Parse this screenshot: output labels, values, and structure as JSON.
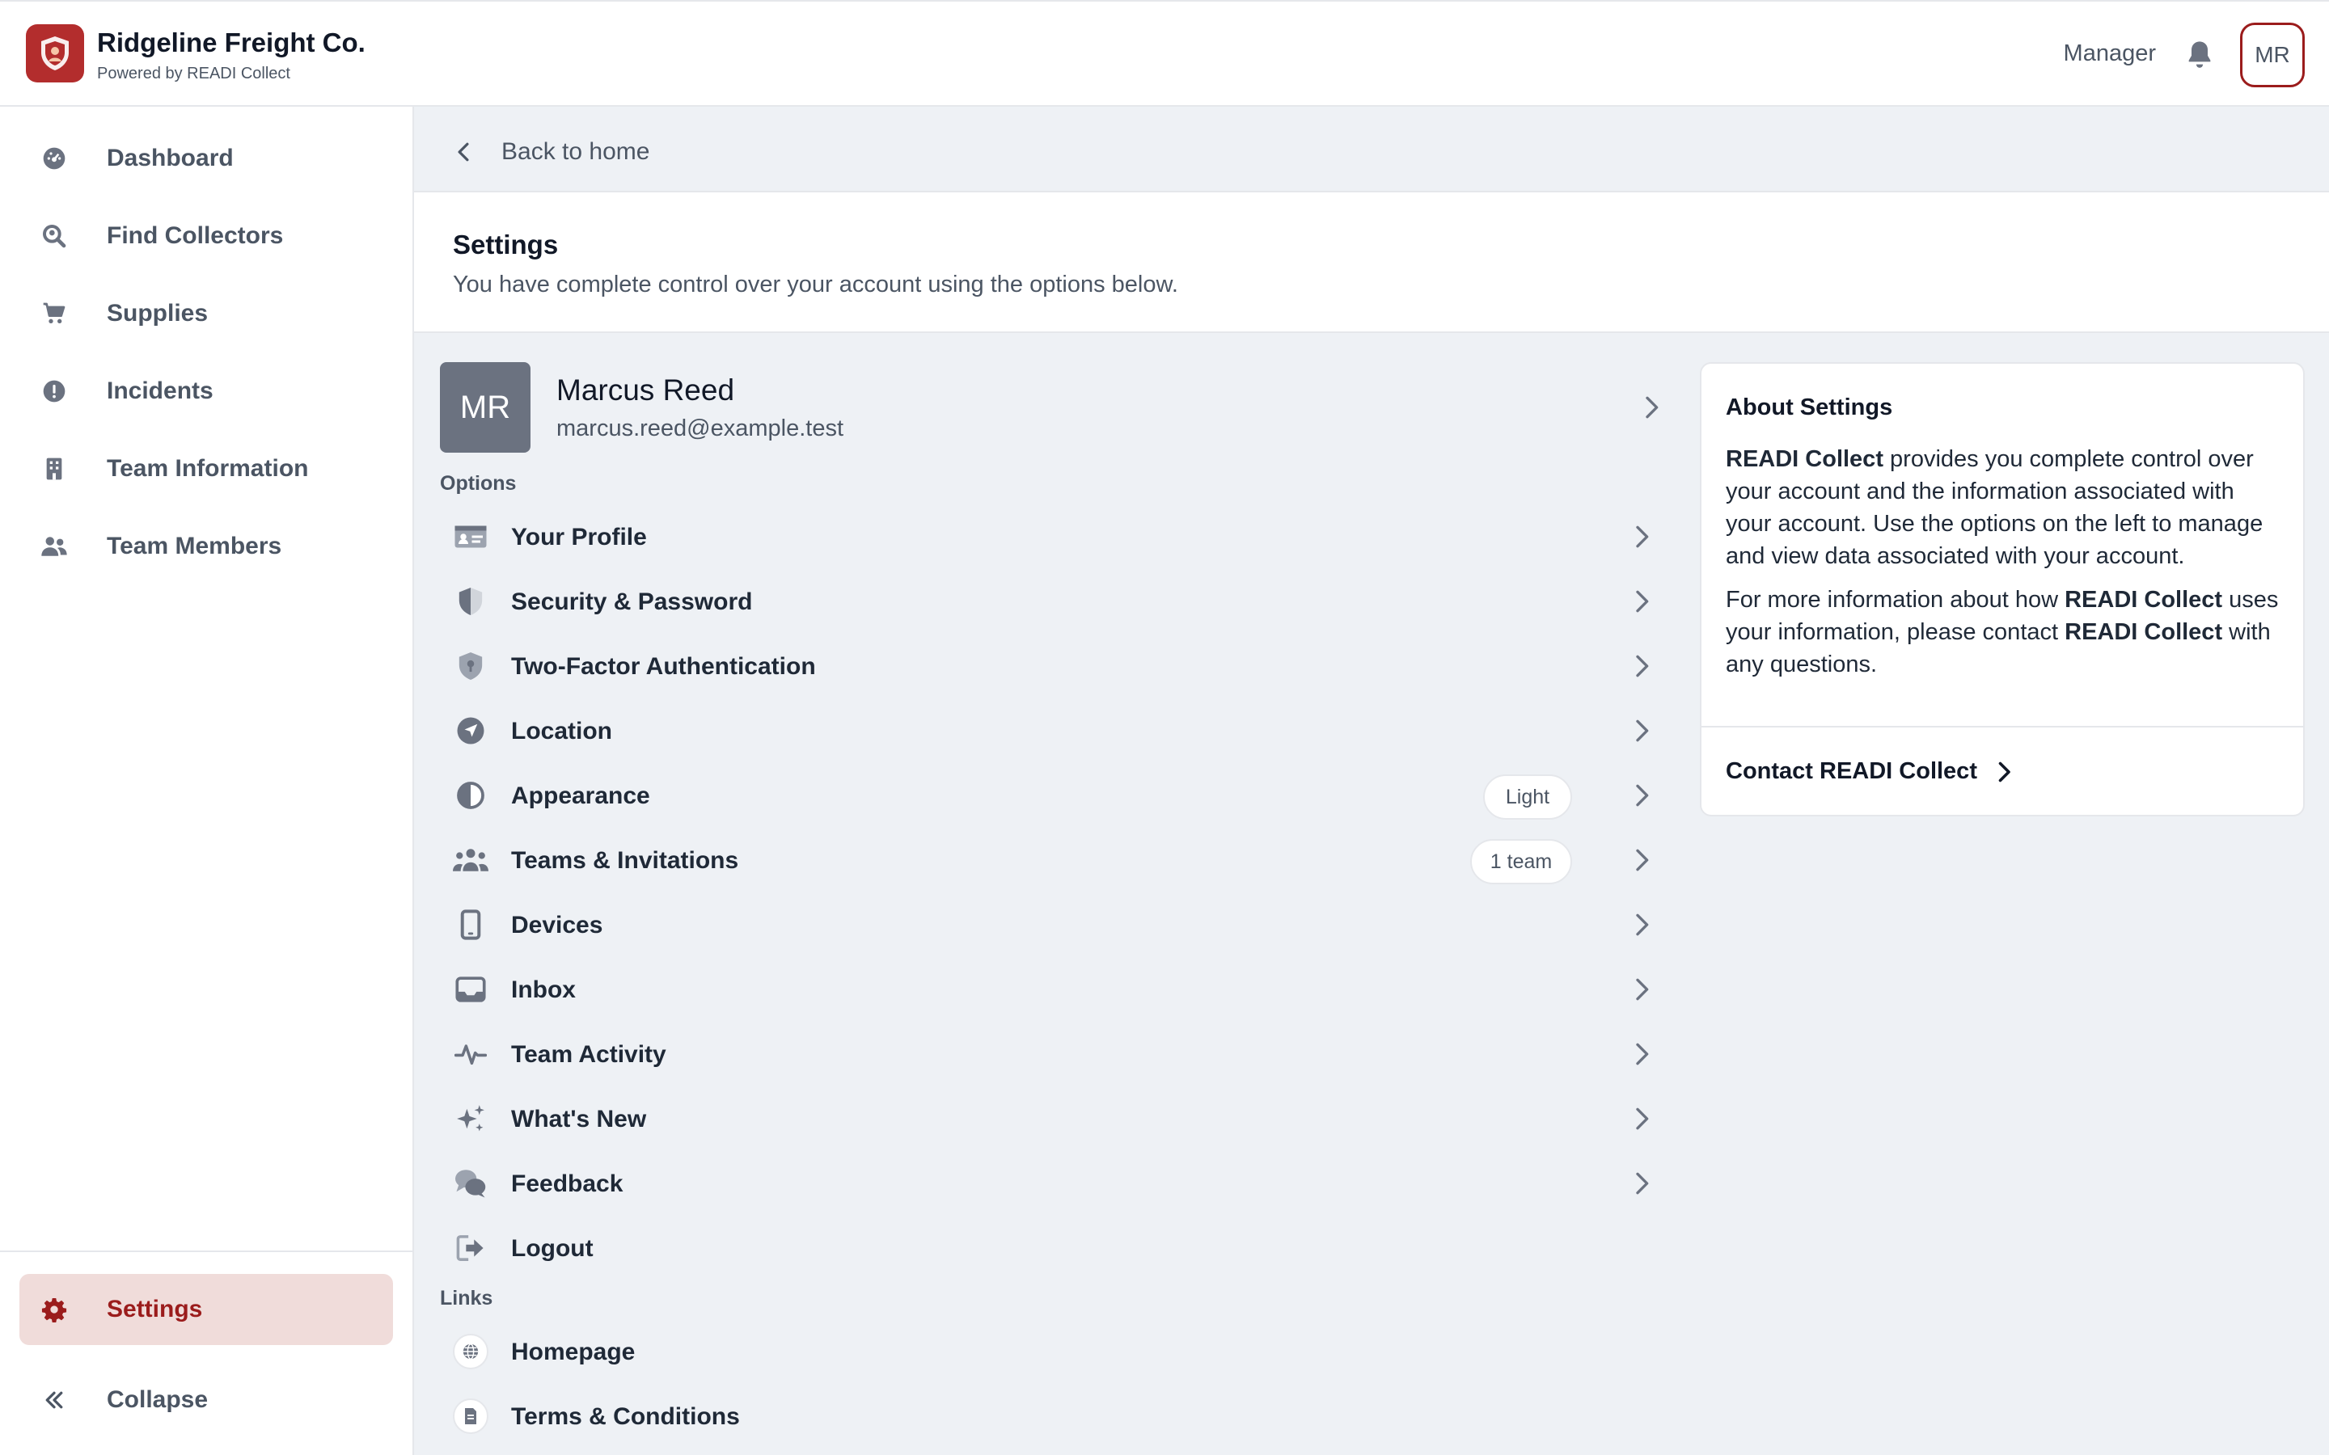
{
  "header": {
    "brand_title": "Ridgeline Freight Co.",
    "brand_subtitle": "Powered by READI Collect",
    "role": "Manager",
    "avatar_initials": "MR"
  },
  "sidebar": {
    "items": [
      {
        "label": "Dashboard",
        "icon": "dashboard-gauge-icon"
      },
      {
        "label": "Find Collectors",
        "icon": "search-location-icon"
      },
      {
        "label": "Supplies",
        "icon": "cart-icon"
      },
      {
        "label": "Incidents",
        "icon": "alert-circle-icon"
      },
      {
        "label": "Team Information",
        "icon": "building-icon"
      },
      {
        "label": "Team Members",
        "icon": "users-icon"
      }
    ],
    "settings_label": "Settings",
    "collapse_label": "Collapse"
  },
  "main": {
    "back_label": "Back to home",
    "title": "Settings",
    "subtitle": "You have complete control over your account using the options below.",
    "profile": {
      "initials": "MR",
      "name": "Marcus Reed",
      "email": "marcus.reed@example.test"
    },
    "options_label": "Options",
    "options": [
      {
        "label": "Your Profile",
        "icon": "id-card-icon"
      },
      {
        "label": "Security & Password",
        "icon": "shield-half-icon"
      },
      {
        "label": "Two-Factor Authentication",
        "icon": "shield-lock-icon"
      },
      {
        "label": "Location",
        "icon": "location-arrow-icon"
      },
      {
        "label": "Appearance",
        "icon": "contrast-icon",
        "badge": "Light"
      },
      {
        "label": "Teams & Invitations",
        "icon": "team-icon",
        "badge": "1 team"
      },
      {
        "label": "Devices",
        "icon": "mobile-device-icon"
      },
      {
        "label": "Inbox",
        "icon": "inbox-icon"
      },
      {
        "label": "Team Activity",
        "icon": "activity-pulse-icon"
      },
      {
        "label": "What's New",
        "icon": "sparkles-icon"
      },
      {
        "label": "Feedback",
        "icon": "chat-bubbles-icon"
      },
      {
        "label": "Logout",
        "icon": "logout-icon"
      }
    ],
    "links_label": "Links",
    "links": [
      {
        "label": "Homepage",
        "icon": "globe-icon"
      },
      {
        "label": "Terms & Conditions",
        "icon": "document-icon"
      }
    ]
  },
  "about": {
    "title": "About Settings",
    "p1_brand": "READI Collect",
    "p1_text": " provides you complete control over your account and the information associated with your account. Use the options on the left to manage and view data associated with your account.",
    "p2_a": "For more information about how ",
    "p2_brand1": "READI Collect",
    "p2_b": " uses your information, please contact ",
    "p2_brand2": "READI Collect",
    "p2_c": " with any questions.",
    "contact_label": "Contact READI Collect"
  },
  "colors": {
    "brand": "#b32d2d",
    "active_bg": "#f0dcda",
    "active_text": "#9b1c1c",
    "icon_gray": "#6b7280"
  }
}
